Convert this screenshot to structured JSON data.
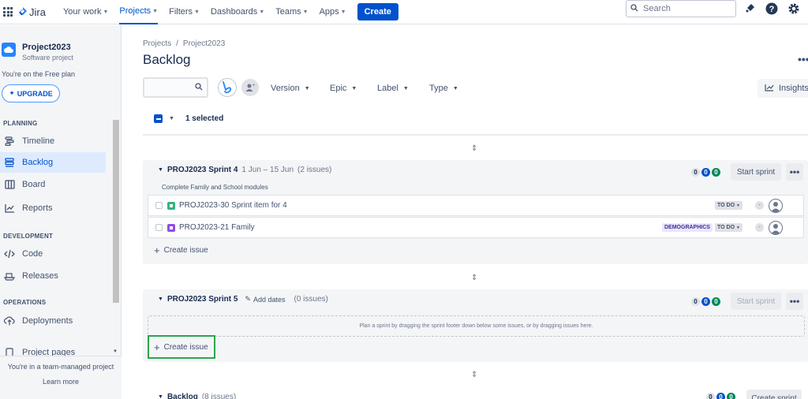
{
  "topnav": {
    "app_name": "Jira",
    "items": [
      {
        "label": "Your work"
      },
      {
        "label": "Projects"
      },
      {
        "label": "Filters"
      },
      {
        "label": "Dashboards"
      },
      {
        "label": "Teams"
      },
      {
        "label": "Apps"
      }
    ],
    "create_label": "Create",
    "search_placeholder": "Search",
    "accent": "#0052cc"
  },
  "sidebar": {
    "project_name": "Project2023",
    "project_type": "Software project",
    "plan_text": "You're on the Free plan",
    "upgrade_label": "UPGRADE",
    "planning_label": "PLANNING",
    "planning_items": [
      "Timeline",
      "Backlog",
      "Board",
      "Reports"
    ],
    "development_label": "DEVELOPMENT",
    "development_items": [
      "Code",
      "Releases"
    ],
    "operations_label": "OPERATIONS",
    "operations_items": [
      "Deployments"
    ],
    "extra_item": "Project pages",
    "footer_text": "You're in a team-managed project",
    "learn_more": "Learn more"
  },
  "main": {
    "breadcrumb": [
      "Projects",
      "/",
      "Project2023"
    ],
    "title": "Backlog",
    "filters": [
      "Version",
      "Epic",
      "Label",
      "Type"
    ],
    "insights_label": "Insights",
    "selected_text": "1 selected",
    "sprint4": {
      "name": "PROJ2023 Sprint 4",
      "dates": "1 Jun – 15 Jun",
      "count": "(2 issues)",
      "goal": "Complete Family and School modules",
      "counts": [
        "0",
        "0",
        "0"
      ],
      "button": "Start sprint",
      "issues": [
        {
          "key_title": "PROJ2023-30 Sprint item for 4",
          "status": "TO DO",
          "estimate": "-",
          "epic": ""
        },
        {
          "key_title": "PROJ2023-21 Family",
          "status": "TO DO",
          "estimate": "-",
          "epic": "DEMOGRAPHICS"
        }
      ],
      "create_issue": "Create issue"
    },
    "sprint5": {
      "name": "PROJ2023 Sprint 5",
      "add_dates": "Add dates",
      "count": "(0 issues)",
      "counts": [
        "0",
        "0",
        "0"
      ],
      "button": "Start sprint",
      "empty_text": "Plan a sprint by dragging the sprint footer down below some issues, or by dragging issues here.",
      "create_issue": "Create issue"
    },
    "backlog": {
      "name": "Backlog",
      "count": "(8 issues)",
      "counts": [
        "0",
        "0",
        "0"
      ],
      "button": "Create sprint"
    }
  }
}
